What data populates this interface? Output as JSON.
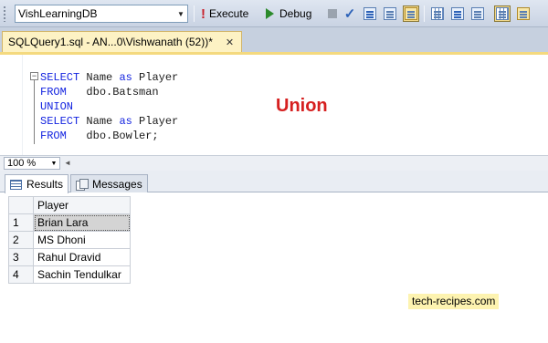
{
  "toolbar": {
    "database": "VishLearningDB",
    "execute_label": "Execute",
    "debug_label": "Debug"
  },
  "tabs": {
    "active_title": "SQLQuery1.sql - AN...0\\Vishwanath (52))*"
  },
  "editor": {
    "lines": [
      [
        {
          "t": "SELECT",
          "k": true
        },
        {
          "t": " Name ",
          "k": false
        },
        {
          "t": "as",
          "k": true
        },
        {
          "t": " Player",
          "k": false
        }
      ],
      [
        {
          "t": "FROM",
          "k": true
        },
        {
          "t": "   dbo.Batsman",
          "k": false
        }
      ],
      [
        {
          "t": "UNION",
          "k": true
        }
      ],
      [
        {
          "t": "SELECT",
          "k": true
        },
        {
          "t": " Name ",
          "k": false
        },
        {
          "t": "as",
          "k": true
        },
        {
          "t": " Player",
          "k": false
        }
      ],
      [
        {
          "t": "FROM",
          "k": true
        },
        {
          "t": "   dbo.Bowler;",
          "k": false
        }
      ]
    ],
    "overlay_title": "Union"
  },
  "zoom": {
    "value": "100 %"
  },
  "results_tabs": {
    "results_label": "Results",
    "messages_label": "Messages"
  },
  "results": {
    "column_header": "Player",
    "rows": [
      {
        "num": "1",
        "player": "Brian Lara"
      },
      {
        "num": "2",
        "player": "MS Dhoni"
      },
      {
        "num": "3",
        "player": "Rahul Dravid"
      },
      {
        "num": "4",
        "player": "Sachin Tendulkar"
      }
    ]
  },
  "watermark": "tech-recipes.com",
  "colors": {
    "keyword": "#1424e0",
    "overlay_title": "#d62020",
    "tab_background": "#fdf2c4",
    "watermark_background": "#fdf3b0"
  }
}
